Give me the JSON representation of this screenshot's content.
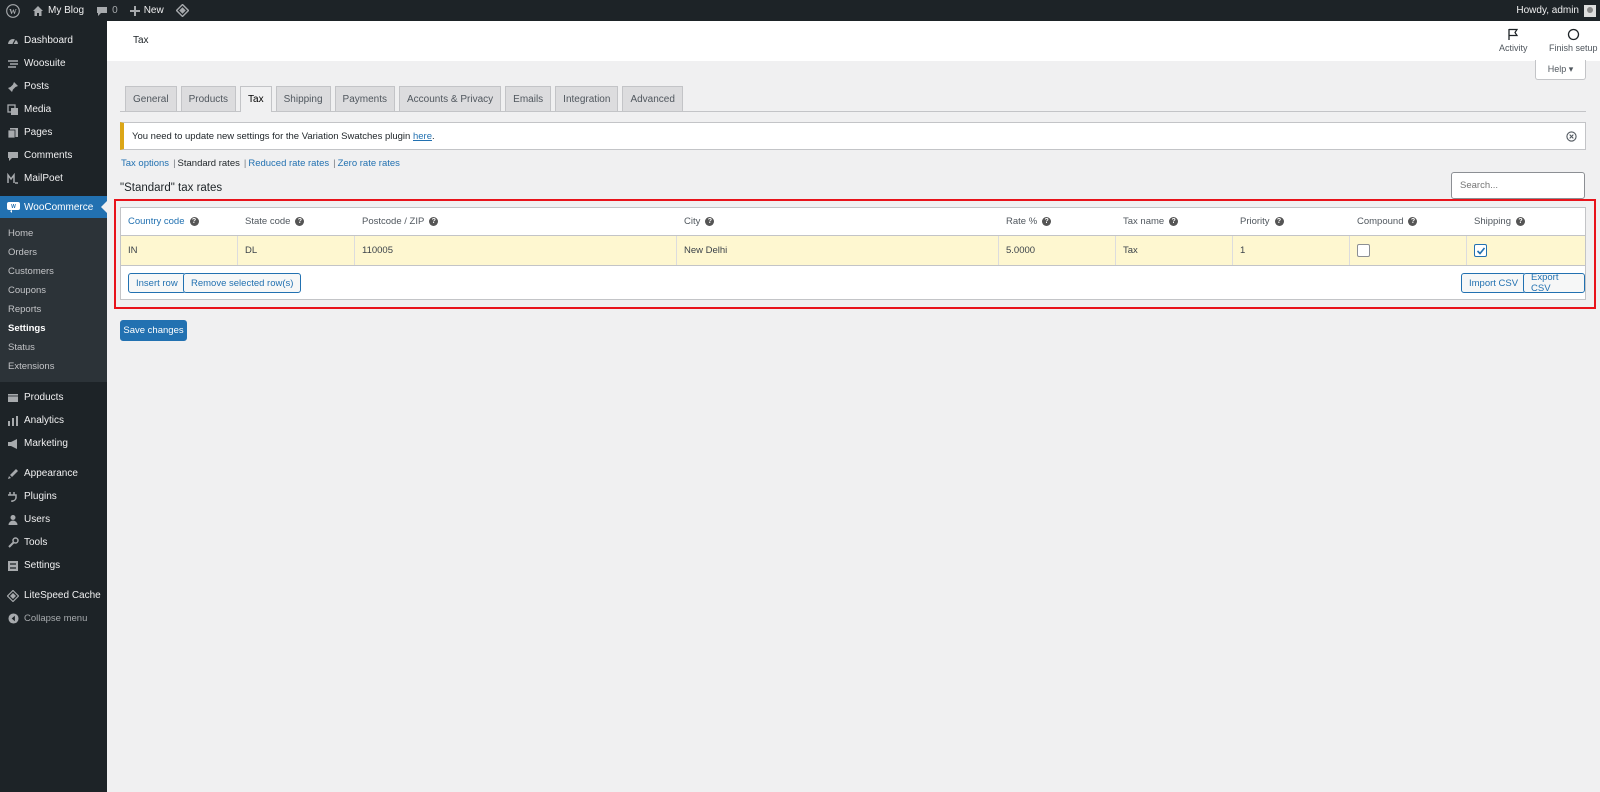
{
  "adminbar": {
    "site_name": "My Blog",
    "comments_count": "0",
    "new_label": "New",
    "howdy": "Howdy, admin"
  },
  "sidebar": {
    "items_top": [
      {
        "label": "Dashboard",
        "icon": "dashboard-icon"
      },
      {
        "label": "Woosuite",
        "icon": "woosuite-icon"
      },
      {
        "label": "Posts",
        "icon": "pin-icon"
      },
      {
        "label": "Media",
        "icon": "media-icon"
      },
      {
        "label": "Pages",
        "icon": "pages-icon"
      },
      {
        "label": "Comments",
        "icon": "comments-icon"
      },
      {
        "label": "MailPoet",
        "icon": "mailpoet-icon"
      }
    ],
    "woocommerce": "WooCommerce",
    "submenu": [
      "Home",
      "Orders",
      "Customers",
      "Coupons",
      "Reports",
      "Settings",
      "Status",
      "Extensions"
    ],
    "items_bottom": [
      {
        "label": "Products",
        "icon": "products-icon"
      },
      {
        "label": "Analytics",
        "icon": "analytics-icon"
      },
      {
        "label": "Marketing",
        "icon": "marketing-icon"
      },
      {
        "label": "Appearance",
        "icon": "appearance-icon"
      },
      {
        "label": "Plugins",
        "icon": "plugins-icon"
      },
      {
        "label": "Users",
        "icon": "users-icon"
      },
      {
        "label": "Tools",
        "icon": "tools-icon"
      },
      {
        "label": "Settings",
        "icon": "settings-icon"
      },
      {
        "label": "LiteSpeed Cache",
        "icon": "litespeed-icon"
      }
    ],
    "collapse": "Collapse menu"
  },
  "header": {
    "title": "Tax",
    "activity": "Activity",
    "finish_setup": "Finish setup",
    "help": "Help ▾"
  },
  "tabs": [
    "General",
    "Products",
    "Tax",
    "Shipping",
    "Payments",
    "Accounts & Privacy",
    "Emails",
    "Integration",
    "Advanced"
  ],
  "notice": {
    "text": "You need to update new settings for the Variation Swatches plugin ",
    "link": "here",
    "end": "."
  },
  "subsub": {
    "tax_options": "Tax options",
    "standard": "Standard rates",
    "reduced": "Reduced rate rates",
    "zero": "Zero rate rates"
  },
  "heading": "\"Standard\" tax rates",
  "search_placeholder": "Search...",
  "table": {
    "columns": [
      "Country code",
      "State code",
      "Postcode / ZIP",
      "City",
      "Rate %",
      "Tax name",
      "Priority",
      "Compound",
      "Shipping"
    ],
    "row": {
      "country": "IN",
      "state": "DL",
      "postcode": "110005",
      "city": "New Delhi",
      "rate": "5.0000",
      "name": "Tax",
      "priority": "1",
      "compound": false,
      "shipping": true
    },
    "buttons": {
      "insert": "Insert row",
      "remove": "Remove selected row(s)",
      "import": "Import CSV",
      "export": "Export CSV"
    }
  },
  "save_label": "Save changes",
  "colors": {
    "accent": "#2271b1",
    "sidebar": "#1d2327",
    "highlight": "#e8131b",
    "row_highlight": "#fef7d0"
  }
}
